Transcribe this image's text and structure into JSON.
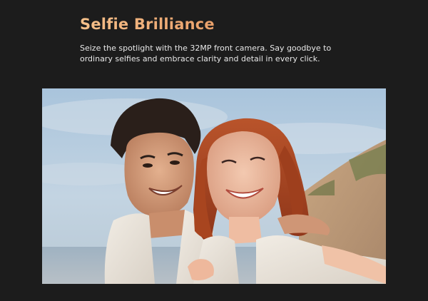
{
  "section": {
    "title": "Selfie Brilliance",
    "description": "Seize the spotlight with the 32MP front camera. Say goodbye to ordinary selfies and embrace clarity and detail in every click."
  },
  "colors": {
    "background": "#1c1c1c",
    "title_gradient_start": "#f5c08a",
    "title_gradient_end": "#eaa06a",
    "body_text": "#e8e8e8"
  },
  "image": {
    "subject": "couple-selfie-beach-photo"
  }
}
